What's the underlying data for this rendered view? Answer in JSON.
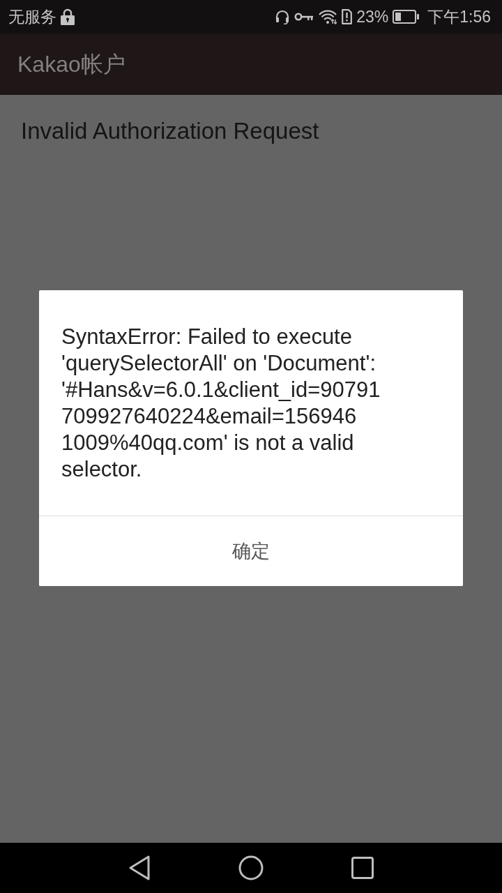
{
  "status_bar": {
    "carrier": "无服务",
    "battery_percent": "23%",
    "time": "下午1:56"
  },
  "app_bar": {
    "title": "Kakao帐户"
  },
  "page": {
    "message": "Invalid Authorization Request"
  },
  "dialog": {
    "message": "SyntaxError: Failed to execute\n'querySelectorAll' on 'Document':\n'#Hans&v=6.0.1&client_id=90791\n709927640224&email=156946\n1009%40qq.com' is not a valid\nselector.",
    "buttons": [
      "确定"
    ]
  }
}
